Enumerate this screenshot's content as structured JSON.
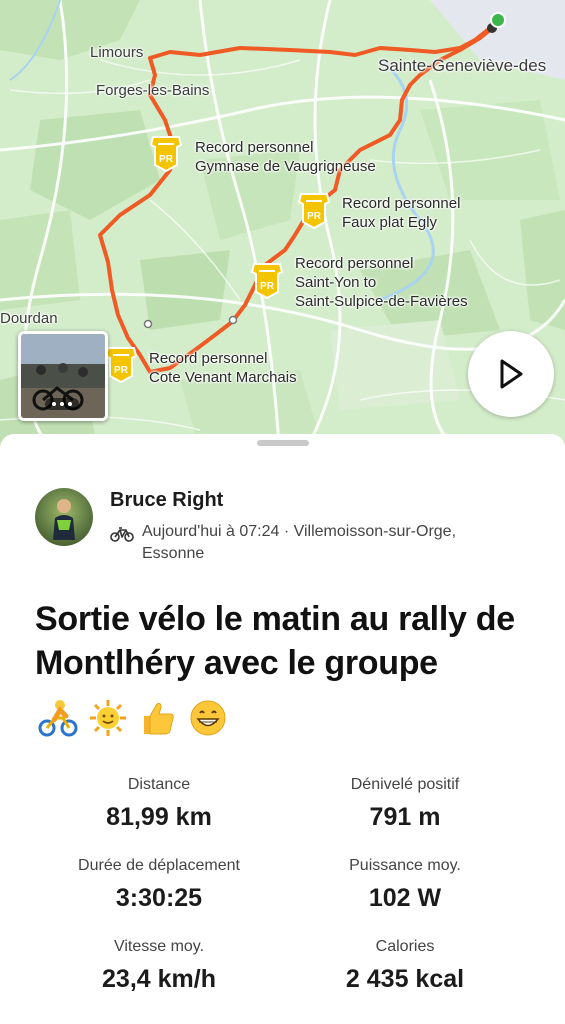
{
  "map": {
    "places": {
      "limours": "Limours",
      "forges": "Forges-les-Bains",
      "sainte_genevieve": "Sainte-Geneviève-des",
      "dourdan": "Dourdan"
    },
    "records": [
      {
        "line1": "Record personnel",
        "line2": "Gymnase de Vaugrigneuse",
        "line3": ""
      },
      {
        "line1": "Record personnel",
        "line2": "Faux plat Egly",
        "line3": ""
      },
      {
        "line1": "Record personnel",
        "line2": "Saint-Yon to",
        "line3": "Saint-Sulpice-de-Favières"
      },
      {
        "line1": "Record personnel",
        "line2": "Cote Venant Marchais",
        "line3": ""
      }
    ],
    "pr_badge_text": "PR",
    "route_color": "#f05a24",
    "start_color": "#3cb54a",
    "play_icon": "play-icon"
  },
  "activity": {
    "athlete": "Bruce Right",
    "sport_icon": "bike-icon",
    "meta": "Aujourd'hui à 07:24 · Villemoisson-sur-Orge, Essonne",
    "title": "Sortie vélo le matin au rally de Montlhéry avec le groupe",
    "emojis": [
      "cyclist-emoji",
      "sun-emoji",
      "thumbs-up-emoji",
      "grin-emoji"
    ]
  },
  "stats": [
    {
      "label": "Distance",
      "value": "81,99 km"
    },
    {
      "label": "Dénivelé positif",
      "value": "791 m"
    },
    {
      "label": "Durée de déplacement",
      "value": "3:30:25"
    },
    {
      "label": "Puissance moy.",
      "value": "102 W"
    },
    {
      "label": "Vitesse moy.",
      "value": "23,4 km/h"
    },
    {
      "label": "Calories",
      "value": "2 435 kcal"
    }
  ]
}
